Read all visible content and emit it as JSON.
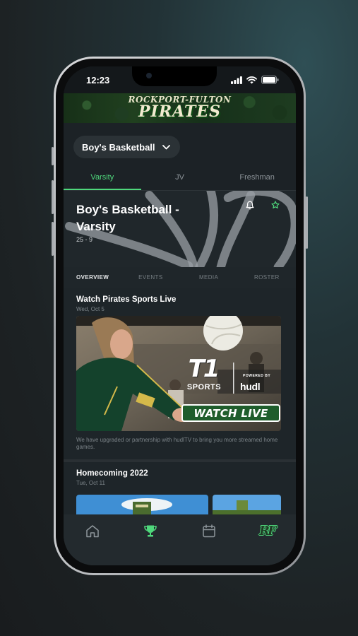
{
  "status_bar": {
    "time": "12:23"
  },
  "banner": {
    "logo_line1": "ROCKPORT-FULTON",
    "logo_line2": "PIRATES"
  },
  "sport_selector": {
    "value": "Boy's Basketball",
    "icon": "chevron-down-icon"
  },
  "level_tabs": [
    {
      "label": "Varsity",
      "active": true
    },
    {
      "label": "JV",
      "active": false
    },
    {
      "label": "Freshman",
      "active": false
    }
  ],
  "team": {
    "title": "Boy's Basketball - Varsity",
    "record": "25 - 9"
  },
  "sub_tabs": [
    {
      "label": "OVERVIEW",
      "active": true
    },
    {
      "label": "EVENTS",
      "active": false
    },
    {
      "label": "MEDIA",
      "active": false
    },
    {
      "label": "ROSTER",
      "active": false
    }
  ],
  "feed": {
    "cards": [
      {
        "title": "Watch Pirates Sports Live",
        "date": "Wed, Oct 5",
        "media": {
          "brand_big": "T1",
          "brand_small": "SPORTS",
          "powered_by": "POWERED BY",
          "partner": "hudl",
          "cta": "WATCH LIVE"
        },
        "caption": "We have upgraded or partnership with hudlTV to bring you more streamed home games."
      },
      {
        "title": "Homecoming 2022",
        "date": "Tue, Oct 11"
      }
    ]
  },
  "bottom_nav": [
    {
      "name": "home",
      "icon": "home-icon",
      "active": false
    },
    {
      "name": "sports",
      "icon": "trophy-icon",
      "active": true
    },
    {
      "name": "calendar",
      "icon": "calendar-icon",
      "active": false
    },
    {
      "name": "school",
      "icon": "rf-logo-icon",
      "active": false,
      "label": "RF"
    }
  ],
  "colors": {
    "accent": "#4fd87c",
    "background": "#1c2226",
    "nav": "#232a2e"
  }
}
